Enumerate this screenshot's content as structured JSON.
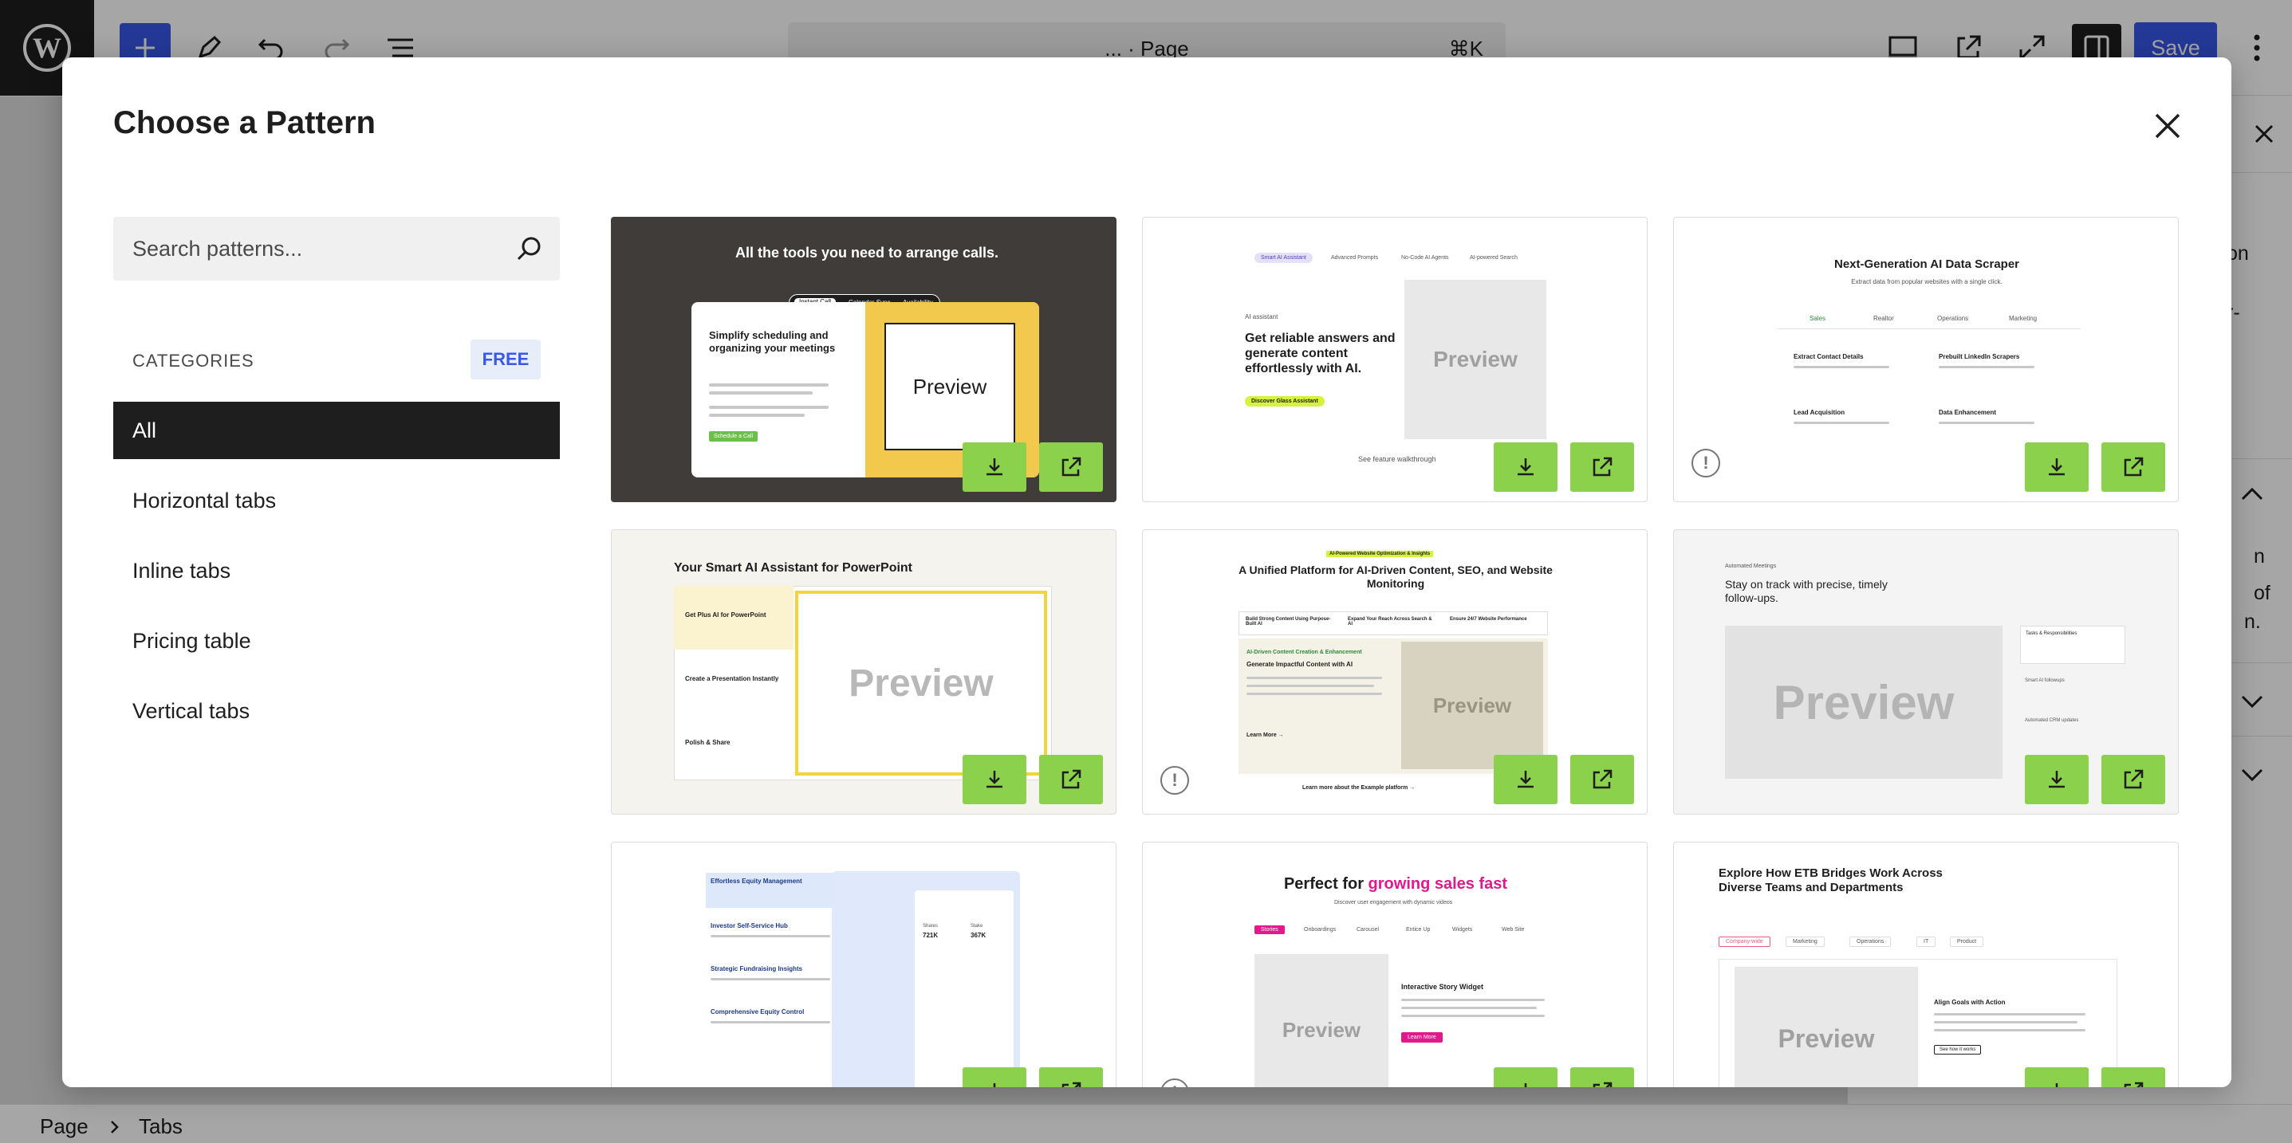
{
  "topbar": {
    "command_title": "... · Page",
    "command_shortcut": "⌘K",
    "save_label": "Save"
  },
  "sidebar": {
    "fragments": [
      "on",
      "r-",
      "n",
      "of",
      "n."
    ]
  },
  "footer": {
    "breadcrumb": [
      "Page",
      "Tabs"
    ]
  },
  "modal": {
    "title": "Choose a Pattern",
    "search_placeholder": "Search patterns...",
    "categories_heading": "CATEGORIES",
    "free_badge": "FREE",
    "categories": [
      "All",
      "Horizontal tabs",
      "Inline tabs",
      "Pricing table",
      "Vertical tabs"
    ],
    "active_category": "All"
  },
  "patterns": [
    {
      "title": "All the tools you need to arrange calls.",
      "sub": "Simplify scheduling and organizing your meetings",
      "tabs": [
        "Instant Call",
        "Calendar Sync",
        "Availability"
      ],
      "cta": "Schedule a Call",
      "preview": "Preview"
    },
    {
      "tabs": [
        "Smart AI Assistant",
        "Advanced Prompts",
        "No-Code AI Agents",
        "AI-powered Search"
      ],
      "kicker": "AI assistant",
      "title": "Get reliable answers and generate content effortlessly with AI.",
      "cta": "Discover Glass Assistant",
      "footer": "See feature walkthrough",
      "preview": "Preview"
    },
    {
      "title": "Next-Generation AI Data Scraper",
      "sub": "Extract data from popular websites with a single click.",
      "tabs": [
        "Sales",
        "Realtor",
        "Operations",
        "Marketing"
      ],
      "items": [
        "Extract Contact Details",
        "Prebuilt LinkedIn Scrapers",
        "Lead Acquisition",
        "Data Enhancement"
      ]
    },
    {
      "title": "Your Smart AI Assistant for PowerPoint",
      "steps": [
        "Get Plus AI for PowerPoint",
        "Create a Presentation Instantly",
        "Polish & Share"
      ],
      "preview": "Preview"
    },
    {
      "kicker": "AI-Powered Website Optimization & Insights",
      "title": "A Unified Platform for AI-Driven Content, SEO, and Website Monitoring",
      "features": [
        "Build Strong Content Using Purpose-Built AI",
        "Expand Your Reach Across Search & AI",
        "Ensure 24/7 Website Performance"
      ],
      "sub_kicker": "AI-Driven Content Creation & Enhancement",
      "sub_title": "Generate Impactful Content with AI",
      "cta": "Learn More →",
      "footer": "Learn more about the Example platform →",
      "preview": "Preview"
    },
    {
      "kicker": "Automated Meetings",
      "title": "Stay on track with precise, timely follow-ups.",
      "side": [
        "Tasks & Responsibilities",
        "Smart AI followups",
        "Automated CRM updates"
      ],
      "preview": "Preview"
    },
    {
      "items": [
        "Effortless Equity Management",
        "Investor Self-Service Hub",
        "Strategic Fundraising Insights",
        "Comprehensive Equity Control"
      ],
      "stats": [
        "Shares",
        "721K",
        "Stake",
        "367K"
      ]
    },
    {
      "title_a": "Perfect for ",
      "title_b": "growing sales fast",
      "sub": "Discover user engagement with dynamic videos",
      "tabs": [
        "Stories",
        "Onboardings",
        "Carousel",
        "Entice Up",
        "Widgets",
        "Web Site"
      ],
      "widget_title": "Interactive Story Widget",
      "cta": "Learn More",
      "preview": "Preview"
    },
    {
      "title": "Explore How ETB Bridges Work Across Diverse Teams and Departments",
      "tabs": [
        "Company-wide",
        "Marketing",
        "Operations",
        "IT",
        "Product"
      ],
      "card_title": "Align Goals with Action",
      "cta": "See how it works",
      "preview": "Preview"
    }
  ],
  "colors": {
    "accent": "#3858e9",
    "download_green": "#8bd14b",
    "active_category": "#1e1e1e"
  },
  "icons": [
    "wordpress-logo-icon",
    "plus-icon",
    "pencil-icon",
    "undo-icon",
    "redo-icon",
    "list-view-icon",
    "desktop-icon",
    "external-link-icon",
    "fullscreen-icon",
    "settings-panel-icon",
    "more-vertical-icon",
    "close-icon",
    "search-icon",
    "download-icon",
    "external-link-icon",
    "warning-icon",
    "chevron-right-icon"
  ]
}
